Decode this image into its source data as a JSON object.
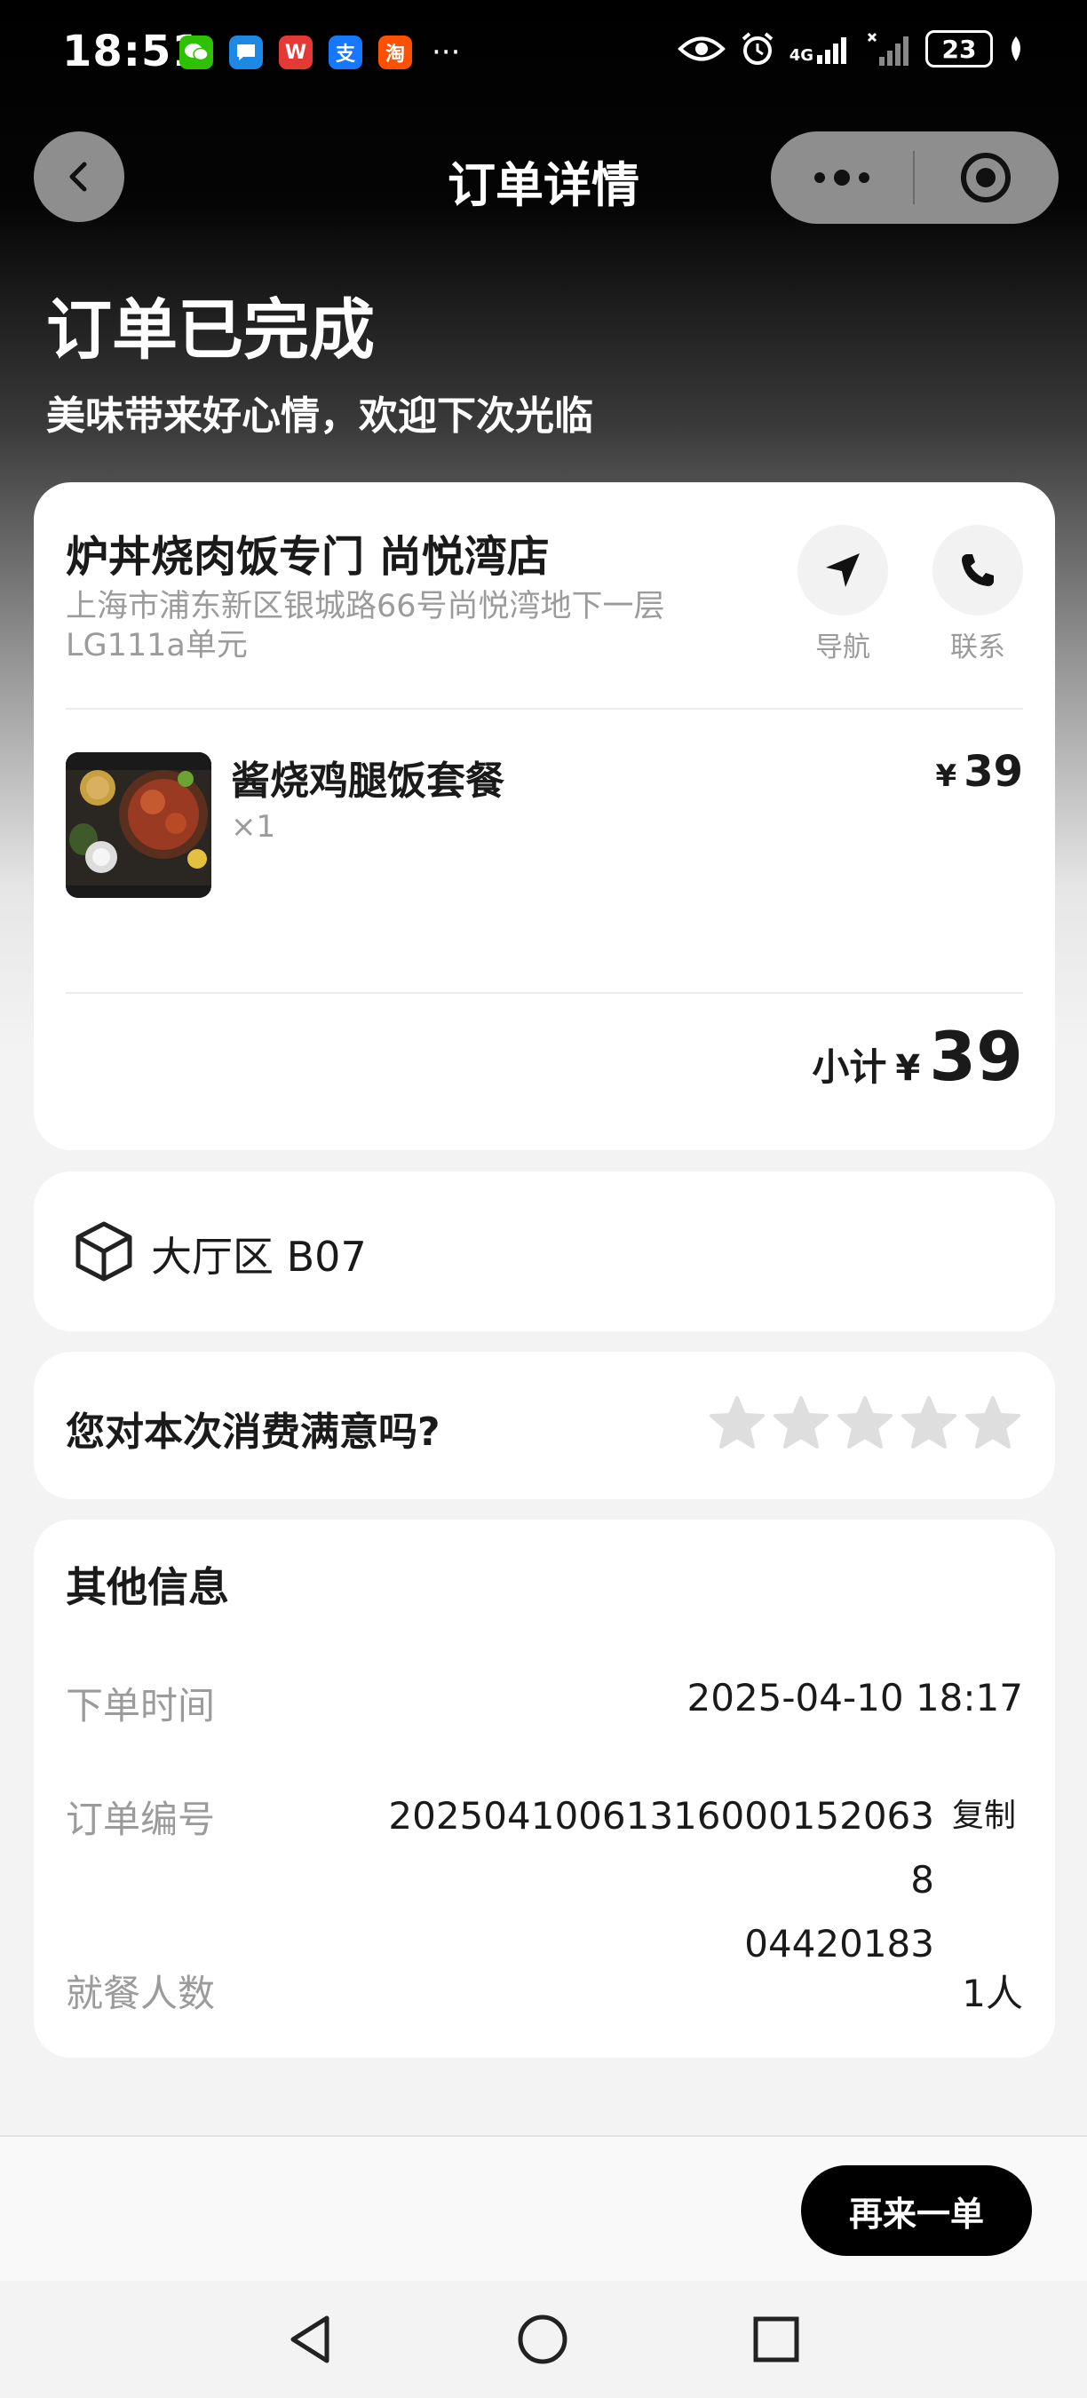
{
  "status_bar": {
    "time": "18:51",
    "apps": [
      {
        "name": "wechat-icon",
        "glyph": "",
        "color": "#2dc100"
      },
      {
        "name": "messages-icon",
        "glyph": "",
        "color": "#1e88e5"
      },
      {
        "name": "wps-icon",
        "glyph": "W",
        "color": "#e53935"
      },
      {
        "name": "alipay-icon",
        "glyph": "支",
        "color": "#1677ff"
      },
      {
        "name": "taobao-icon",
        "glyph": "淘",
        "color": "#ff5000"
      }
    ],
    "more": "···",
    "network": "4G",
    "battery": "23"
  },
  "nav": {
    "title": "订单详情"
  },
  "hero": {
    "status": "订单已完成",
    "subtitle": "美味带来好心情，欢迎下次光临"
  },
  "store": {
    "name": "炉丼烧肉饭专门 尚悦湾店",
    "address": "上海市浦东新区银城路66号尚悦湾地下一层LG111a单元",
    "nav_label": "导航",
    "contact_label": "联系"
  },
  "item": {
    "name": "酱烧鸡腿饭套餐",
    "qty": "×1",
    "currency": "¥",
    "price": "39"
  },
  "subtotal": {
    "label": "小计",
    "currency": "¥",
    "value": "39"
  },
  "table": {
    "text": "大厅区 B07"
  },
  "rating": {
    "question": "您对本次消费满意吗?",
    "stars_total": 5,
    "stars_selected": 0
  },
  "info": {
    "title": "其他信息",
    "order_time_label": "下单时间",
    "order_time": "2025-04-10 18:17",
    "order_no_label": "订单编号",
    "order_no": "2025041006131600015206 3804420183",
    "order_no_display": "202504100613160001520638 04420183",
    "copy_label": "复制",
    "diners_label": "就餐人数",
    "diners": "1人"
  },
  "bottom": {
    "reorder_label": "再来一单"
  }
}
